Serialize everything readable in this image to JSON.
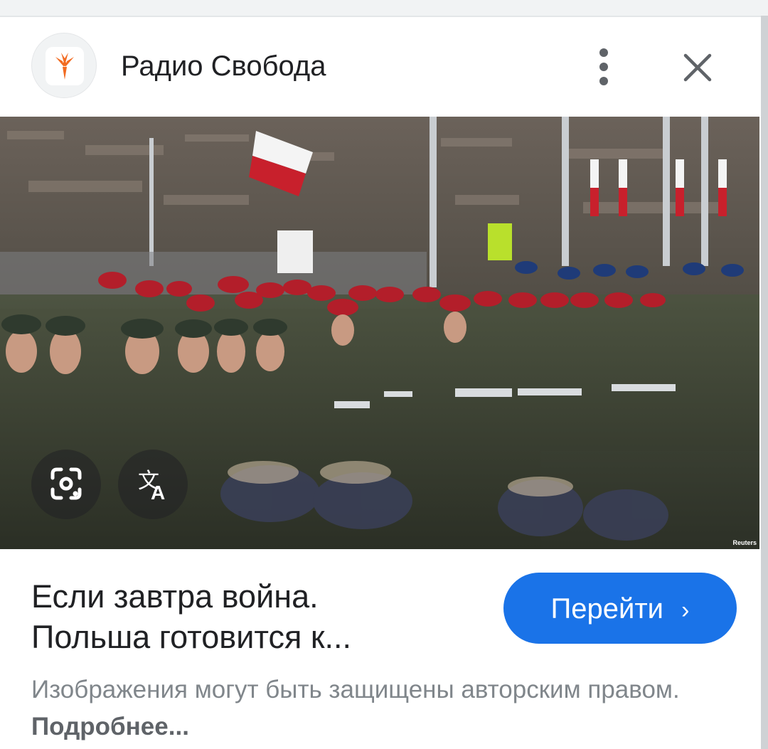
{
  "header": {
    "site_name": "Радио Свобода",
    "logo_icon": "rfe-torch-logo-icon",
    "menu_icon": "more-vert-icon",
    "close_icon": "close-icon"
  },
  "image": {
    "alt": "",
    "credit": "Reuters",
    "lens_icon": "google-lens-icon",
    "translate_icon": "translate-icon"
  },
  "result": {
    "headline_line1": "Если завтра война.",
    "headline_line2": "Польша готовится к...",
    "go_label": "Перейти",
    "go_icon": "chevron-right-icon"
  },
  "notice": {
    "text": "Изображения могут быть защищены авторским правом.",
    "more_link": "Подробнее..."
  },
  "colors": {
    "accent": "#1a73e8",
    "logo_orange": "#f26b21",
    "text_primary": "#202124",
    "text_secondary": "#80868b"
  }
}
